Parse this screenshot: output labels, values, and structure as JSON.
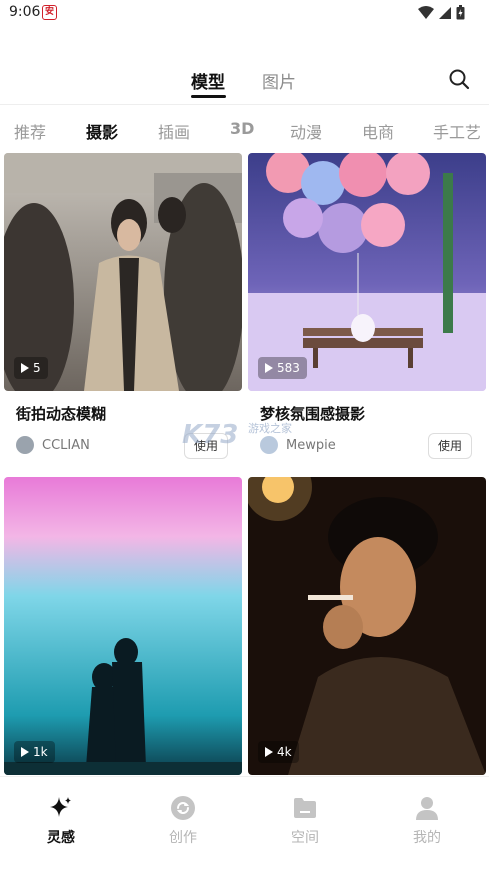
{
  "status_bar": {
    "time": "9:06",
    "badge_icon": "app-badge-icon"
  },
  "top_tabs": [
    {
      "label": "模型",
      "active": true
    },
    {
      "label": "图片",
      "active": false
    }
  ],
  "categories": [
    "推荐",
    "摄影",
    "插画",
    "3D",
    "动漫",
    "电商",
    "手工艺"
  ],
  "active_category": "摄影",
  "cards": [
    {
      "title": "街拍动态模糊",
      "views": "5",
      "author": "CCLIAN",
      "use_label": "使用"
    },
    {
      "title": "梦核氛围感摄影",
      "views": "583",
      "author": "Mewpie",
      "use_label": "使用"
    },
    {
      "title": "",
      "views": "1k",
      "author": "",
      "use_label": ""
    },
    {
      "title": "",
      "views": "4k",
      "author": "",
      "use_label": ""
    }
  ],
  "watermark": {
    "main": "K73",
    "sub": "游戏之家"
  },
  "bottom_nav": [
    {
      "label": "灵感",
      "icon": "sparkle-icon",
      "active": true
    },
    {
      "label": "创作",
      "icon": "create-icon",
      "active": false
    },
    {
      "label": "空间",
      "icon": "folder-icon",
      "active": false
    },
    {
      "label": "我的",
      "icon": "user-icon",
      "active": false
    }
  ],
  "colors": {
    "accent": "#111111",
    "inactive": "#b5b5b5",
    "badge": "#d0202a"
  }
}
